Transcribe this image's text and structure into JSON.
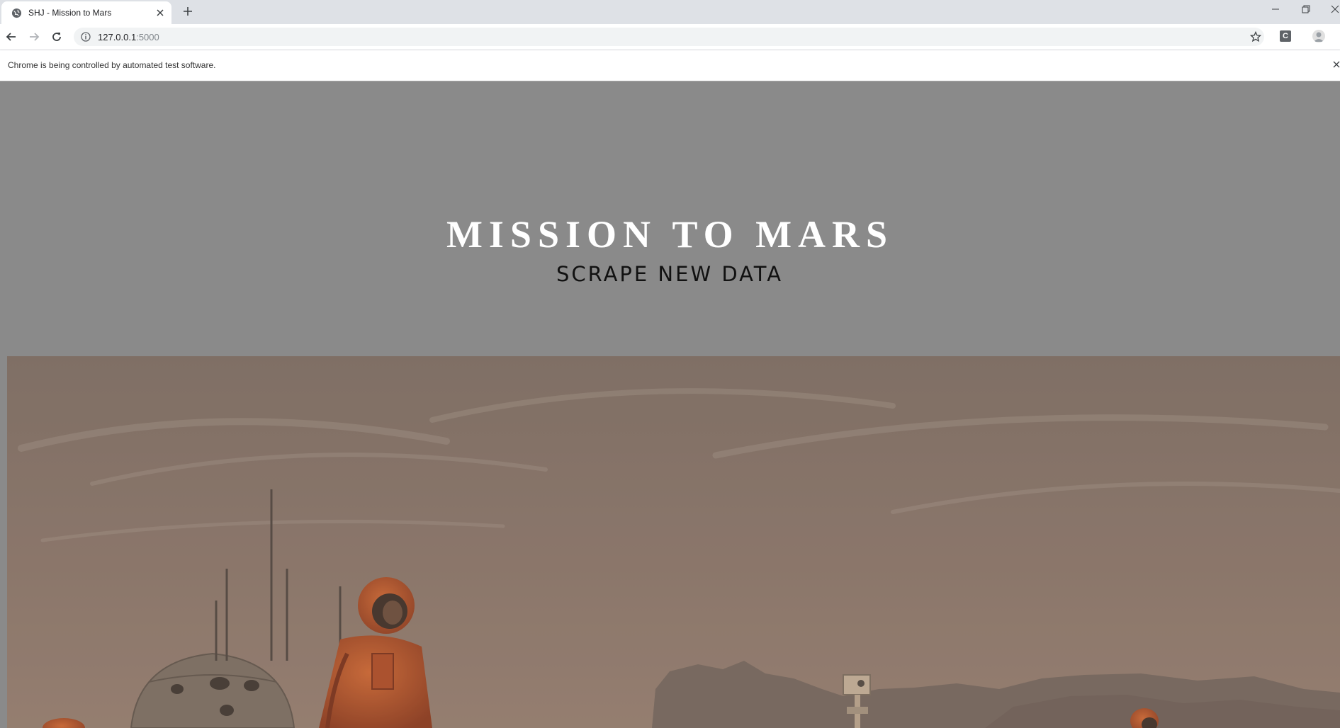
{
  "browser": {
    "tab_title": "SHJ - Mission to Mars",
    "url_host": "127.0.0.1",
    "url_port": ":5000",
    "automation_message": "Chrome is being controlled by automated test software.",
    "extension_letter": "C"
  },
  "page": {
    "title": "MISSION TO MARS",
    "scrape_button_label": "SCRAPE NEW DATA"
  },
  "colors": {
    "page_background": "#8a8a8a",
    "title_text": "#ffffff",
    "button_text": "#111111",
    "image_tint": "#8b766a"
  }
}
